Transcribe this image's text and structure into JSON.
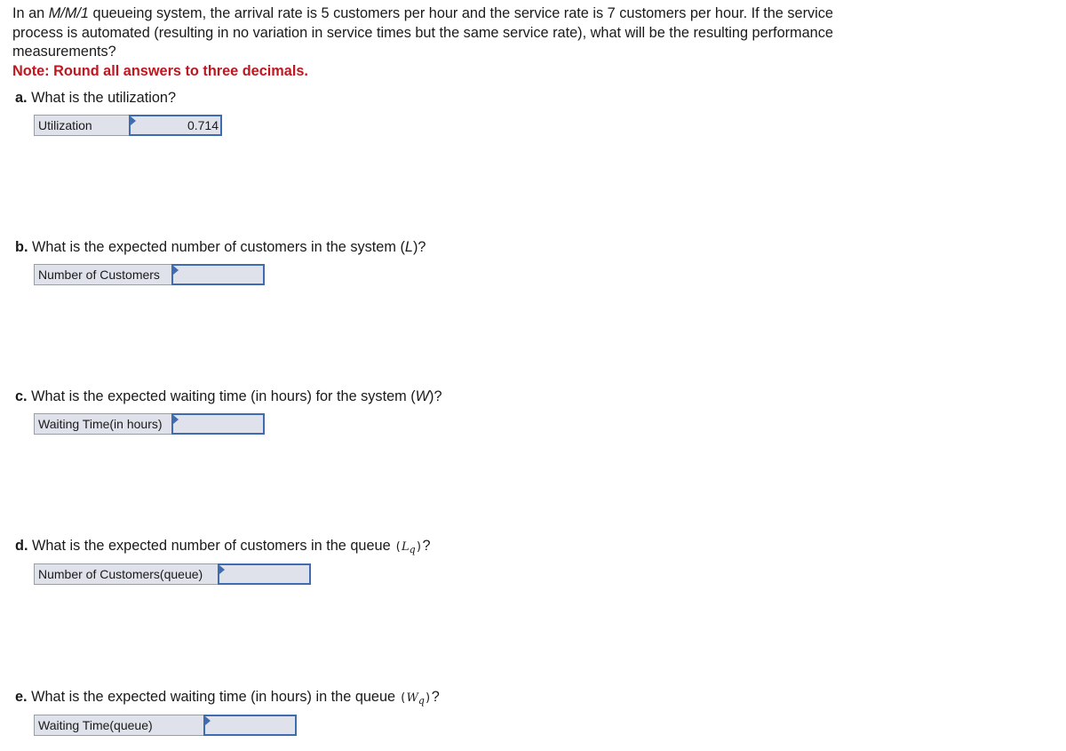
{
  "intro": {
    "text_before_model": "In an ",
    "model": "M/M/1",
    "text_after_model": " queueing system, the arrival rate is 5 customers per hour and the service rate is 7 customers per hour. If the service process is automated (resulting in no variation in service times but the same service rate), what will be the resulting performance measurements?",
    "note": "Note: Round all answers to three decimals."
  },
  "questions": [
    {
      "letter": "a.",
      "text": "What is the utilization?",
      "symbol": "",
      "sub": "",
      "field_label": "Utilization",
      "value": "0.714"
    },
    {
      "letter": "b.",
      "text": "What is the expected number of customers in the system (",
      "symbol": "L",
      "sub": "",
      "tail": ")?",
      "field_label": "Number of Customers",
      "value": ""
    },
    {
      "letter": "c.",
      "text": "What is the expected waiting time (in hours) for the system (",
      "symbol": "W",
      "sub": "",
      "tail": ")?",
      "field_label": "Waiting Time(in hours)",
      "value": ""
    },
    {
      "letter": "d.",
      "text": "What is the expected number of customers in the queue ",
      "symbol": "L",
      "sub": "q",
      "tail": "?",
      "field_label": "Number of Customers(queue)",
      "value": ""
    },
    {
      "letter": "e.",
      "text": "What is the expected waiting time (in hours) in the queue ",
      "symbol": "W",
      "sub": "q",
      "tail": "?",
      "field_label": "Waiting Time(queue)",
      "value": ""
    }
  ]
}
